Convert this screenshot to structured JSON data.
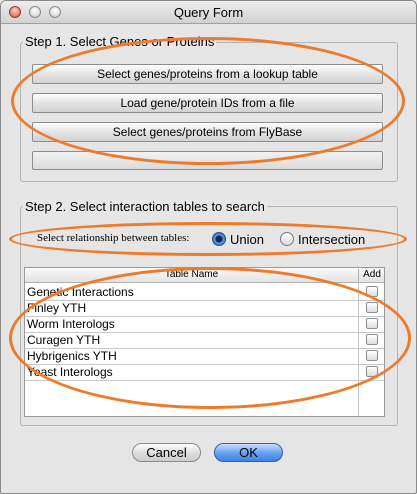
{
  "window": {
    "title": "Query Form"
  },
  "step1": {
    "title": "Step 1. Select Genes or Proteins",
    "buttons": [
      "Select genes/proteins from a lookup table",
      "Load gene/protein IDs from a file",
      "Select genes/proteins from FlyBase"
    ]
  },
  "step2": {
    "title": "Step 2. Select interaction tables to search",
    "relationship_label": "Select relationship between tables:",
    "options": {
      "union": "Union",
      "intersection": "Intersection"
    },
    "selected": "Union",
    "table": {
      "headers": {
        "name": "Table Name",
        "add": "Add"
      },
      "rows": [
        {
          "name": "Genetic Interactions",
          "checked": false
        },
        {
          "name": "Finley YTH",
          "checked": false
        },
        {
          "name": "Worm Interologs",
          "checked": false
        },
        {
          "name": "Curagen YTH",
          "checked": false
        },
        {
          "name": "Hybrigenics YTH",
          "checked": false
        },
        {
          "name": "Yeast Interologs",
          "checked": false
        }
      ]
    }
  },
  "footer": {
    "cancel": "Cancel",
    "ok": "OK"
  },
  "colors": {
    "annotation": "#ef7a2a",
    "selected_radio": "#2c64c4",
    "default_button": "#6aa4f0"
  }
}
